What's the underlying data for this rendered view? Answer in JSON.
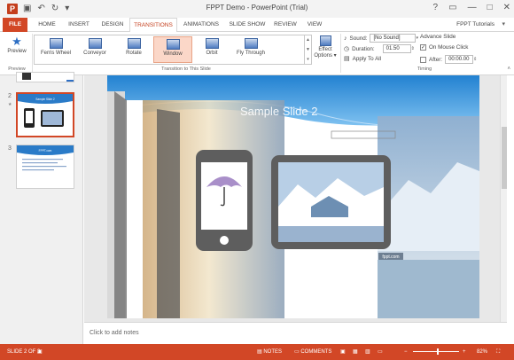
{
  "window": {
    "app_icon": "P",
    "title": "FPPT Demo - PowerPoint (Trial)",
    "qat_icons": [
      "save-icon",
      "undo-icon",
      "redo-icon",
      "customize-icon"
    ],
    "controls": [
      "?",
      "▭",
      "—",
      "□",
      "✕"
    ]
  },
  "tabs": [
    "FILE",
    "HOME",
    "INSERT",
    "DESIGN",
    "TRANSITIONS",
    "ANIMATIONS",
    "SLIDE SHOW",
    "REVIEW",
    "VIEW"
  ],
  "active_tab": "TRANSITIONS",
  "account": "FPPT Tutorials",
  "ribbon": {
    "preview": {
      "label": "Preview",
      "group": "Preview"
    },
    "transitions": [
      "Ferris Wheel",
      "Conveyor",
      "Rotate",
      "Window",
      "Orbit",
      "Fly Through"
    ],
    "selected_transition": "Window",
    "effect_options_line1": "Effect",
    "effect_options_line2": "Options",
    "group_transition": "Transition to This Slide",
    "timing": {
      "sound_label": "Sound:",
      "sound_value": "[No Sound]",
      "duration_label": "Duration:",
      "duration_value": "01.50",
      "apply_all": "Apply To All",
      "advance_label": "Advance Slide",
      "on_click": "On Mouse Click",
      "on_click_checked": true,
      "after_label": "After:",
      "after_value": "00:00.00",
      "after_checked": false,
      "group": "Timing"
    }
  },
  "thumbnails": [
    {
      "number": "2",
      "title": "Sample Slide 2"
    },
    {
      "number": "3",
      "title": "FPPT.com"
    }
  ],
  "slide": {
    "title": "Sample Slide 2",
    "caption": "fppt.com"
  },
  "notes_placeholder": "Click to add notes",
  "status": {
    "slide_info": "SLIDE 2 OF 3",
    "notes": "NOTES",
    "comments": "COMMENTS",
    "zoom": "82%"
  },
  "colors": {
    "accent": "#d24726",
    "ribbon_accent": "#c43e1c",
    "selection": "#fbd7c8"
  }
}
